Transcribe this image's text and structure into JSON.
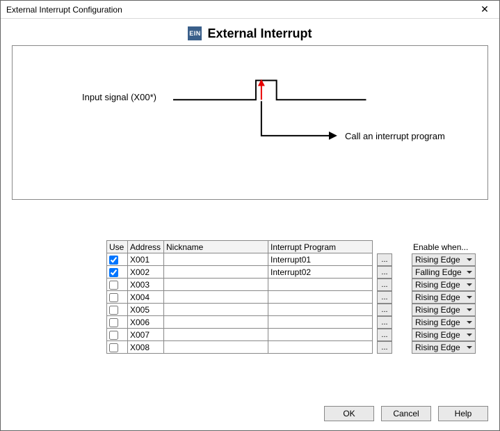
{
  "window": {
    "title": "External Interrupt Configuration",
    "close_glyph": "✕"
  },
  "header": {
    "icon_text": "EIN",
    "title": "External Interrupt"
  },
  "diagram": {
    "input_label": "Input signal (X00*)",
    "call_label": "Call an interrupt program"
  },
  "table": {
    "cols": {
      "use": "Use",
      "addr": "Address",
      "nick": "Nickname",
      "iprog": "Interrupt Program"
    },
    "enable_header": "Enable when...",
    "browse_label": "...",
    "rows": [
      {
        "use": true,
        "addr": "X001",
        "nick": "",
        "iprog": "Interrupt01",
        "edge": "Rising Edge"
      },
      {
        "use": true,
        "addr": "X002",
        "nick": "",
        "iprog": "Interrupt02",
        "edge": "Falling Edge"
      },
      {
        "use": false,
        "addr": "X003",
        "nick": "",
        "iprog": "",
        "edge": "Rising Edge"
      },
      {
        "use": false,
        "addr": "X004",
        "nick": "",
        "iprog": "",
        "edge": "Rising Edge"
      },
      {
        "use": false,
        "addr": "X005",
        "nick": "",
        "iprog": "",
        "edge": "Rising Edge"
      },
      {
        "use": false,
        "addr": "X006",
        "nick": "",
        "iprog": "",
        "edge": "Rising Edge"
      },
      {
        "use": false,
        "addr": "X007",
        "nick": "",
        "iprog": "",
        "edge": "Rising Edge"
      },
      {
        "use": false,
        "addr": "X008",
        "nick": "",
        "iprog": "",
        "edge": "Rising Edge"
      }
    ]
  },
  "buttons": {
    "ok": "OK",
    "cancel": "Cancel",
    "help": "Help"
  }
}
